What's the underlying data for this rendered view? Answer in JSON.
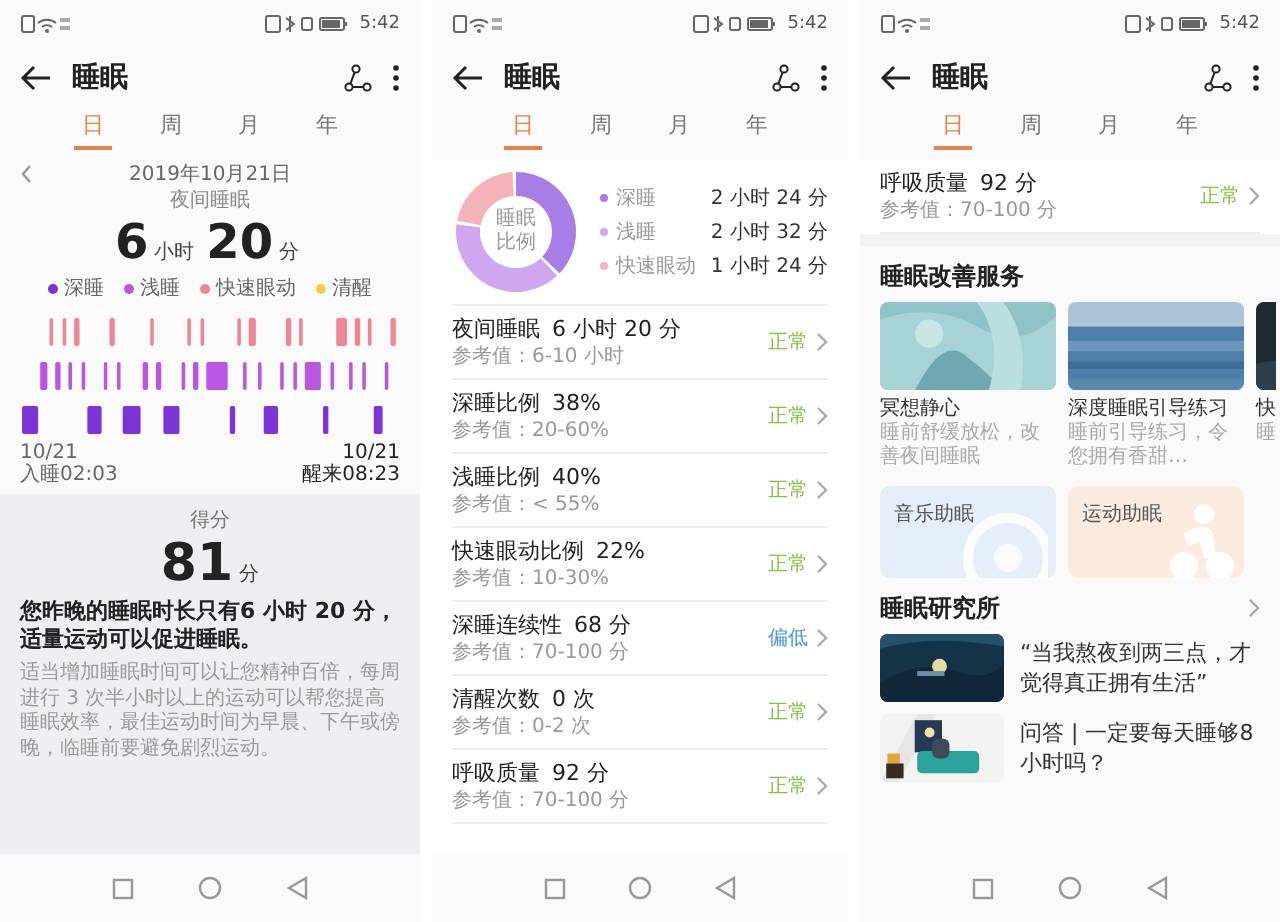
{
  "phones": [
    {
      "kind": "overview",
      "status_time": "5:42",
      "title": "睡眠",
      "tabs": [
        {
          "label": "日",
          "selected": true
        },
        {
          "label": "周",
          "selected": false
        },
        {
          "label": "月",
          "selected": false
        },
        {
          "label": "年",
          "selected": false
        }
      ],
      "date": "2019年10月21日",
      "sleep_type": "夜间睡眠",
      "duration": {
        "hours": "6",
        "hours_unit": "小时",
        "minutes": "20",
        "minutes_unit": "分"
      },
      "legend": [
        {
          "label": "深睡",
          "color": "#7b35d6"
        },
        {
          "label": "浅睡",
          "color": "#b957e0"
        },
        {
          "label": "快速眼动",
          "color": "#ee8795"
        },
        {
          "label": "清醒",
          "color": "#f1cf4b"
        }
      ],
      "start": {
        "date": "10/21",
        "time": "入睡02:03"
      },
      "end": {
        "date": "10/21",
        "time": "醒来08:23"
      },
      "score": {
        "label": "得分",
        "value": "81",
        "unit": "分"
      },
      "summary": "您昨晚的睡眠时长只有6 小时 20 分，适量运动可以促进睡眠。",
      "advice": "适当增加睡眠时间可以让您精神百倍，每周进行 3 次半小时以上的运动可以帮您提高睡眠效率，最佳运动时间为早晨、下午或傍晚，临睡前要避免剧烈运动。"
    },
    {
      "kind": "stats",
      "status_time": "5:42",
      "title": "睡眠",
      "tabs": [
        {
          "label": "日",
          "selected": true
        },
        {
          "label": "周",
          "selected": false
        },
        {
          "label": "月",
          "selected": false
        },
        {
          "label": "年",
          "selected": false
        }
      ],
      "donut_label": "睡眠比例",
      "stages": [
        {
          "label": "深睡",
          "value": "2 小时 24 分",
          "color": "#a77ee6"
        },
        {
          "label": "浅睡",
          "value": "2 小时 32 分",
          "color": "#cfa6f0"
        },
        {
          "label": "快速眼动",
          "value": "1 小时 24 分",
          "color": "#f4b3bb"
        }
      ],
      "metrics": [
        {
          "name": "夜间睡眠",
          "value": "6 小时 20 分",
          "reference": "参考值：6-10 小时",
          "status": "正常",
          "kind": "normal"
        },
        {
          "name": "深睡比例",
          "value": "38%",
          "reference": "参考值：20-60%",
          "status": "正常",
          "kind": "normal"
        },
        {
          "name": "浅睡比例",
          "value": "40%",
          "reference": "参考值：< 55%",
          "status": "正常",
          "kind": "normal"
        },
        {
          "name": "快速眼动比例",
          "value": "22%",
          "reference": "参考值：10-30%",
          "status": "正常",
          "kind": "normal"
        },
        {
          "name": "深睡连续性",
          "value": "68 分",
          "reference": "参考值：70-100 分",
          "status": "偏低",
          "kind": "low"
        },
        {
          "name": "清醒次数",
          "value": "0 次",
          "reference": "参考值：0-2 次",
          "status": "正常",
          "kind": "normal"
        },
        {
          "name": "呼吸质量",
          "value": "92 分",
          "reference": "参考值：70-100 分",
          "status": "正常",
          "kind": "normal"
        }
      ]
    },
    {
      "kind": "services",
      "status_time": "5:42",
      "title": "睡眠",
      "tabs": [
        {
          "label": "日",
          "selected": true
        },
        {
          "label": "周",
          "selected": false
        },
        {
          "label": "月",
          "selected": false
        },
        {
          "label": "年",
          "selected": false
        }
      ],
      "metrics": [
        {
          "name": "呼吸质量",
          "value": "92 分",
          "reference": "参考值：70-100 分",
          "status": "正常",
          "kind": "normal"
        }
      ],
      "services_title": "睡眠改善服务",
      "services": [
        {
          "title": "冥想静心",
          "subtitle": "睡前舒缓放松，改善夜间睡眠"
        },
        {
          "title": "深度睡眠引导练习",
          "subtitle": "睡前引导练习，令您拥有香甜…"
        },
        {
          "title": "快",
          "subtitle": "睡"
        }
      ],
      "tiles": [
        {
          "label": "音乐助眠",
          "kind": "music",
          "color": "#e4effa"
        },
        {
          "label": "运动助眠",
          "kind": "exercise",
          "color": "#fcecdf"
        }
      ],
      "research_title": "睡眠研究所",
      "articles": [
        {
          "title": "“当我熬夜到两三点，才觉得真正拥有生活”"
        },
        {
          "title": "问答 | 一定要每天睡够8小时吗？"
        }
      ]
    }
  ]
}
